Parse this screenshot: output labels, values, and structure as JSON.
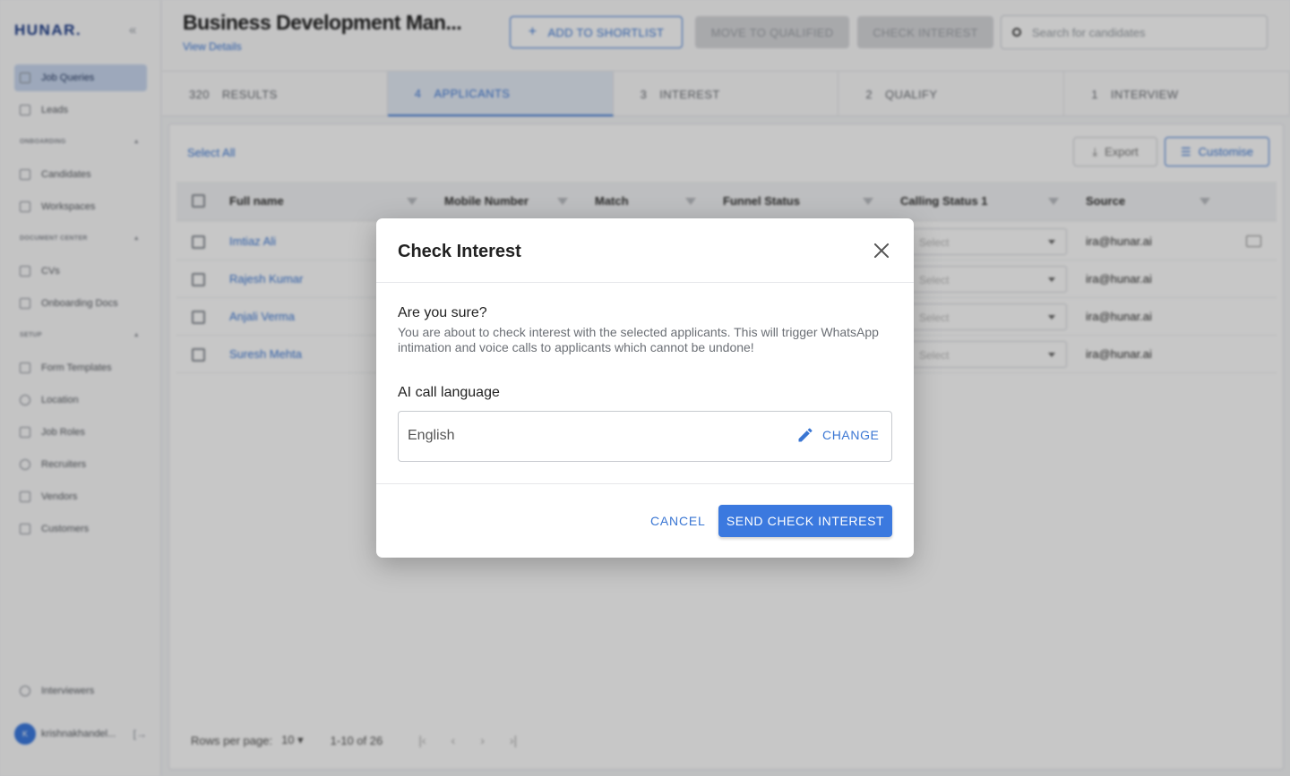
{
  "sidebar": {
    "logo": "HUNAR.",
    "items_top": [
      {
        "label": "Job Queries",
        "icon": "briefcase-icon",
        "active": true
      },
      {
        "label": "Leads",
        "icon": "list-icon"
      }
    ],
    "sections": [
      {
        "label": "ONBOARDING",
        "items": [
          {
            "label": "Candidates",
            "icon": "candidates-icon"
          },
          {
            "label": "Workspaces",
            "icon": "folder-icon"
          }
        ]
      },
      {
        "label": "DOCUMENT CENTER",
        "items": [
          {
            "label": "CVs",
            "icon": "document-icon"
          },
          {
            "label": "Onboarding Docs",
            "icon": "docs-icon"
          }
        ]
      },
      {
        "label": "SETUP",
        "items": [
          {
            "label": "Form Templates",
            "icon": "form-icon"
          },
          {
            "label": "Location",
            "icon": "location-pin-icon"
          },
          {
            "label": "Job Roles",
            "icon": "wrench-icon"
          },
          {
            "label": "Recruiters",
            "icon": "person-icon"
          },
          {
            "label": "Vendors",
            "icon": "vendor-icon"
          },
          {
            "label": "Customers",
            "icon": "building-icon"
          }
        ]
      }
    ],
    "bottom_item": {
      "label": "Interviewers",
      "icon": "headset-icon"
    },
    "user": {
      "initial": "K",
      "name": "krishnakhandel..."
    }
  },
  "header": {
    "job_title": "Business Development Man...",
    "view_details": "View Details",
    "add_to_shortlist": "ADD TO SHORTLIST",
    "move_to_qualified": "MOVE TO QUALIFIED",
    "check_interest": "CHECK INTEREST",
    "search_placeholder": "Search for candidates"
  },
  "tabs": [
    {
      "count": "320",
      "label": "RESULTS"
    },
    {
      "count": "4",
      "label": "APPLICANTS",
      "active": true
    },
    {
      "count": "3",
      "label": "INTEREST"
    },
    {
      "count": "2",
      "label": "QUALIFY"
    },
    {
      "count": "1",
      "label": "INTERVIEW"
    }
  ],
  "table": {
    "select_all": "Select All",
    "export": "Export",
    "customise": "Customise",
    "columns": [
      "Full name",
      "Mobile Number",
      "Match",
      "Funnel Status",
      "Calling Status 1",
      "Source"
    ],
    "rows": [
      {
        "name": "Imtiaz Ali",
        "calling": "Select",
        "source": "ira@hunar.ai"
      },
      {
        "name": "Rajesh Kumar",
        "calling": "Select",
        "source": "ira@hunar.ai"
      },
      {
        "name": "Anjali Verma",
        "calling": "Select",
        "source": "ira@hunar.ai"
      },
      {
        "name": "Suresh Mehta",
        "calling": "Select",
        "source": "ira@hunar.ai"
      }
    ],
    "rows_per_page_label": "Rows per page:",
    "rows_per_page": "10",
    "range": "1-10 of 26"
  },
  "modal": {
    "title": "Check Interest",
    "question": "Are you sure?",
    "warning": "You are about to check interest with the selected applicants. This will trigger WhatsApp intimation and voice calls to applicants which cannot be undone!",
    "language_label": "AI call language",
    "language_value": "English",
    "change_label": "CHANGE",
    "cancel_label": "CANCEL",
    "send_label": "SEND CHECK INTEREST"
  },
  "colors": {
    "accent": "#3b79df",
    "overlay": "rgba(0,0,0,0.22)"
  }
}
